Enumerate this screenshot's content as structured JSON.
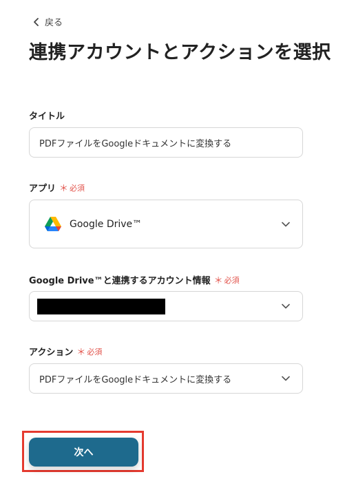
{
  "header": {
    "back_label": "戻る",
    "title": "連携アカウントとアクションを選択"
  },
  "form": {
    "title_field": {
      "label": "タイトル",
      "value": "PDFファイルをGoogleドキュメントに変換する"
    },
    "app_field": {
      "label": "アプリ",
      "required_mark": "＊",
      "required_text": "必須",
      "value": "Google Drive™",
      "icon": "google-drive-icon"
    },
    "account_field": {
      "label": "Google Drive™と連携するアカウント情報",
      "required_mark": "＊",
      "required_text": "必須",
      "value_redacted": true
    },
    "action_field": {
      "label": "アクション",
      "required_mark": "＊",
      "required_text": "必須",
      "value": "PDFファイルをGoogleドキュメントに変換する"
    }
  },
  "footer": {
    "next_label": "次へ",
    "next_color": "#1e6a8d",
    "highlight_color": "#e53a2f"
  },
  "colors": {
    "required": "#e2534b",
    "border": "#d6d6d6"
  }
}
